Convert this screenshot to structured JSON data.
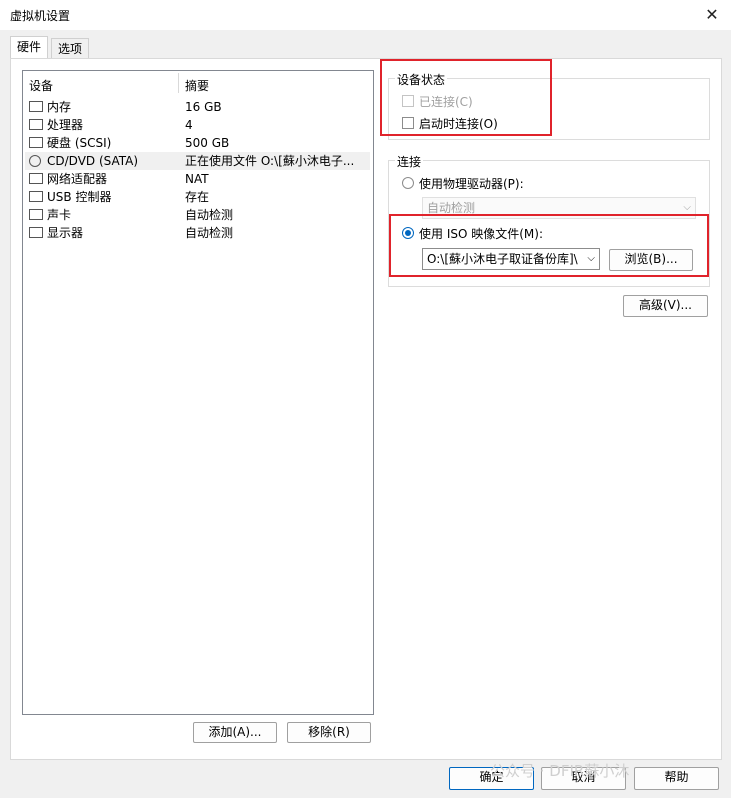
{
  "window": {
    "title": "虚拟机设置"
  },
  "tabs": [
    {
      "label": "硬件"
    },
    {
      "label": "选项"
    }
  ],
  "device_list": {
    "columns": [
      "设备",
      "摘要"
    ],
    "rows": [
      {
        "name": "内存",
        "summary": "16 GB",
        "icon": "memory-icon"
      },
      {
        "name": "处理器",
        "summary": "4",
        "icon": "processor-icon"
      },
      {
        "name": "硬盘 (SCSI)",
        "summary": "500 GB",
        "icon": "hard-disk-icon"
      },
      {
        "name": "CD/DVD (SATA)",
        "summary": "正在使用文件 O:\\[蘇小沐电子...",
        "icon": "cd-dvd-icon"
      },
      {
        "name": "网络适配器",
        "summary": "NAT",
        "icon": "network-adapter-icon"
      },
      {
        "name": "USB 控制器",
        "summary": "存在",
        "icon": "usb-icon"
      },
      {
        "name": "声卡",
        "summary": "自动检测",
        "icon": "sound-card-icon"
      },
      {
        "name": "显示器",
        "summary": "自动检测",
        "icon": "display-icon"
      }
    ]
  },
  "list_buttons": {
    "add": "添加(A)...",
    "remove": "移除(R)"
  },
  "device_status": {
    "title": "设备状态",
    "connected": "已连接(C)",
    "connect_at_power_on": "启动时连接(O)"
  },
  "connection": {
    "title": "连接",
    "use_physical_drive": "使用物理驱动器(P):",
    "physical_drive_value": "自动检测",
    "use_iso": "使用 ISO 映像文件(M):",
    "iso_path": "O:\\[蘇小沐电子取证备份库]\\",
    "browse": "浏览(B)..."
  },
  "advanced_button": "高级(V)...",
  "footer": {
    "ok": "确定",
    "cancel": "取消",
    "help": "帮助"
  },
  "watermark": "公众号 · DFIR蘇小沐",
  "colors": {
    "highlight_box": "#e0232b",
    "accent": "#0067c0"
  }
}
